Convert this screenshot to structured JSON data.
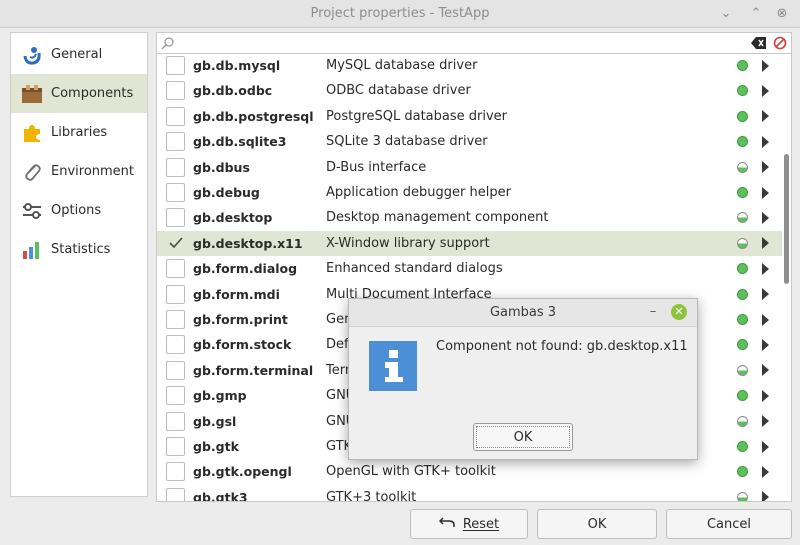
{
  "window": {
    "title": "Project properties - TestApp",
    "min_glyph": "⌄",
    "restore_glyph": "⌃",
    "close_glyph": "⊗"
  },
  "sidebar": {
    "items": [
      {
        "label": "General",
        "icon": "gambas-logo-icon",
        "active": false
      },
      {
        "label": "Components",
        "icon": "components-box-icon",
        "active": true
      },
      {
        "label": "Libraries",
        "icon": "puzzle-piece-icon",
        "active": false
      },
      {
        "label": "Environment",
        "icon": "paperclip-icon",
        "active": false
      },
      {
        "label": "Options",
        "icon": "sliders-icon",
        "active": false
      },
      {
        "label": "Statistics",
        "icon": "bar-chart-icon",
        "active": false
      }
    ]
  },
  "search": {
    "value": "",
    "placeholder": ""
  },
  "components": [
    {
      "name": "gb.db.mysql",
      "desc": "MySQL database driver",
      "status": "green",
      "checked": false
    },
    {
      "name": "gb.db.odbc",
      "desc": "ODBC database driver",
      "status": "green",
      "checked": false
    },
    {
      "name": "gb.db.postgresql",
      "desc": "PostgreSQL database driver",
      "status": "green",
      "checked": false
    },
    {
      "name": "gb.db.sqlite3",
      "desc": "SQLite 3 database driver",
      "status": "green",
      "checked": false
    },
    {
      "name": "gb.dbus",
      "desc": "D-Bus interface",
      "status": "half",
      "checked": false
    },
    {
      "name": "gb.debug",
      "desc": "Application debugger helper",
      "status": "green",
      "checked": false
    },
    {
      "name": "gb.desktop",
      "desc": "Desktop management component",
      "status": "half",
      "checked": false
    },
    {
      "name": "gb.desktop.x11",
      "desc": "X-Window library support",
      "status": "half",
      "checked": true
    },
    {
      "name": "gb.form.dialog",
      "desc": "Enhanced standard dialogs",
      "status": "green",
      "checked": false
    },
    {
      "name": "gb.form.mdi",
      "desc": "Multi Document Interface",
      "status": "green",
      "checked": false
    },
    {
      "name": "gb.form.print",
      "desc": "Gen",
      "status": "green",
      "checked": false
    },
    {
      "name": "gb.form.stock",
      "desc": "Defa",
      "status": "green",
      "checked": false
    },
    {
      "name": "gb.form.terminal",
      "desc": "Term",
      "status": "half",
      "checked": false
    },
    {
      "name": "gb.gmp",
      "desc": "GNU",
      "status": "green",
      "checked": false
    },
    {
      "name": "gb.gsl",
      "desc": "GNU",
      "status": "half",
      "checked": false
    },
    {
      "name": "gb.gtk",
      "desc": "GTK",
      "status": "green",
      "checked": false
    },
    {
      "name": "gb.gtk.opengl",
      "desc": "OpenGL with GTK+ toolkit",
      "status": "green",
      "checked": false
    },
    {
      "name": "gb.gtk3",
      "desc": "GTK+3 toolkit",
      "status": "half",
      "checked": false
    }
  ],
  "buttons": {
    "reset": "Reset",
    "ok": "OK",
    "cancel": "Cancel"
  },
  "dialog": {
    "title": "Gambas 3",
    "min_glyph": "–",
    "close_glyph": "✕",
    "message": "Component not found: gb.desktop.x11",
    "ok": "OK"
  },
  "colors": {
    "selection": "#e0e6d3",
    "status_green": "#5cc15c",
    "info_blue": "#4c8fd6",
    "dialog_close": "#8cc43f"
  }
}
